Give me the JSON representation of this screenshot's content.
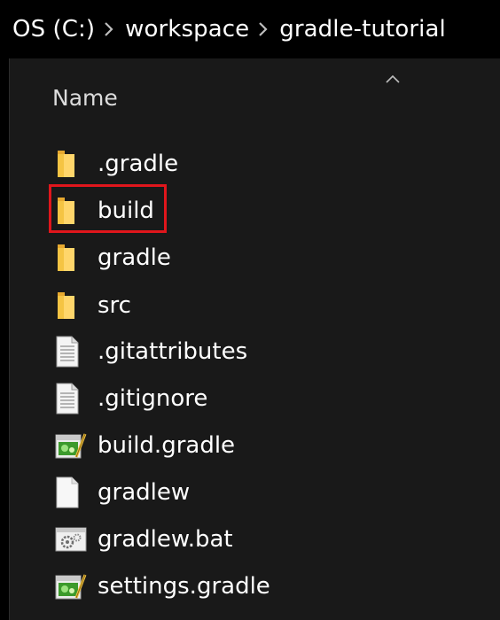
{
  "breadcrumb": {
    "items": [
      "OS (C:)",
      "workspace",
      "gradle-tutorial"
    ]
  },
  "column_header": {
    "name_label": "Name"
  },
  "files": [
    {
      "name": ".gradle",
      "icon": "folder-icon"
    },
    {
      "name": "build",
      "icon": "folder-icon",
      "highlighted": true
    },
    {
      "name": "gradle",
      "icon": "folder-icon"
    },
    {
      "name": "src",
      "icon": "folder-icon"
    },
    {
      "name": ".gitattributes",
      "icon": "text-file-icon"
    },
    {
      "name": ".gitignore",
      "icon": "text-file-icon"
    },
    {
      "name": "build.gradle",
      "icon": "gradle-script-icon"
    },
    {
      "name": "gradlew",
      "icon": "blank-file-icon"
    },
    {
      "name": "gradlew.bat",
      "icon": "batch-file-icon"
    },
    {
      "name": "settings.gradle",
      "icon": "gradle-script-icon"
    }
  ],
  "colors": {
    "background": "#191919",
    "breadcrumb_bg": "#000000",
    "folder": "#f5c443",
    "highlight": "#e0161c",
    "text": "#ffffff"
  }
}
